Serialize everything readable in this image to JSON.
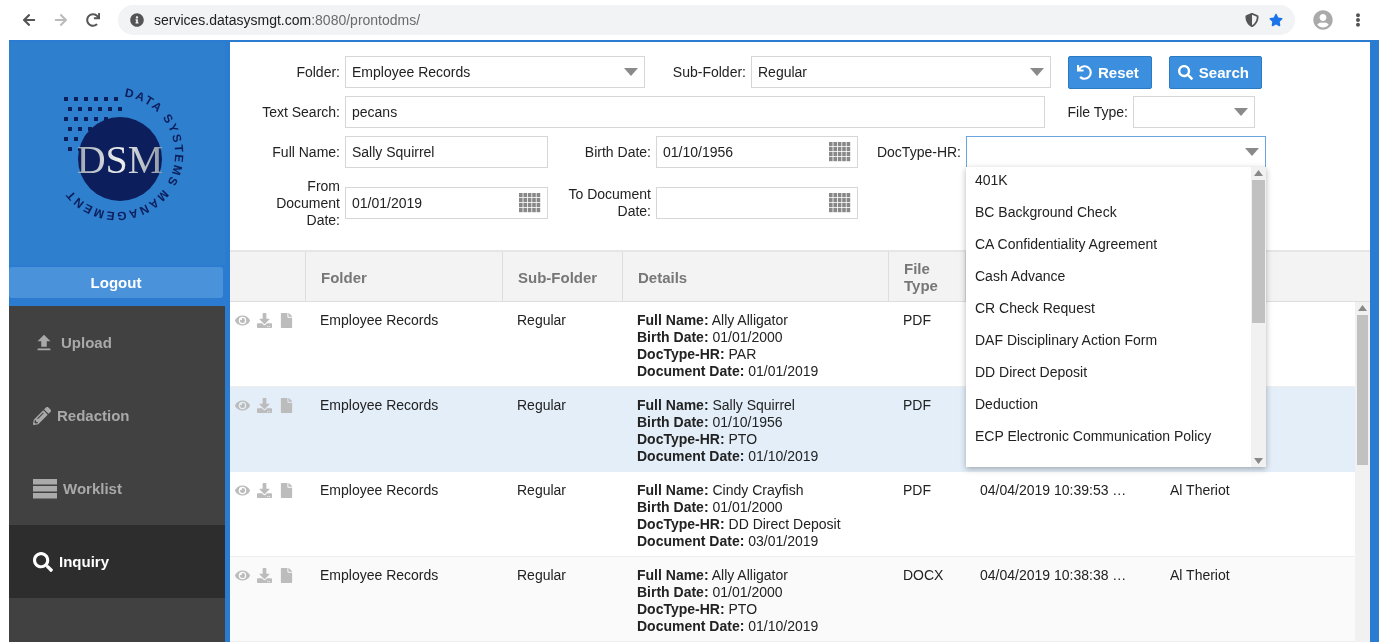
{
  "browser": {
    "url_host": "services.datasysmgt.com",
    "url_path": ":8080/prontodms/"
  },
  "logo": {
    "letters": "DSM",
    "ring_text": "DATA SYSTEMS MANAGEMENT"
  },
  "sidebar": {
    "logout": "Logout",
    "items": [
      {
        "label": "Upload",
        "kind": "upload",
        "selected": false
      },
      {
        "label": "Redaction",
        "kind": "redaction",
        "selected": false
      },
      {
        "label": "Worklist",
        "kind": "worklist",
        "selected": false
      },
      {
        "label": "Inquiry",
        "kind": "inquiry",
        "selected": true
      }
    ]
  },
  "form": {
    "folder": {
      "label": "Folder:",
      "value": "Employee Records"
    },
    "sub_folder": {
      "label": "Sub-Folder:",
      "value": "Regular"
    },
    "reset_button": "Reset",
    "search_button": "Search",
    "text_search": {
      "label": "Text Search:",
      "value": "pecans"
    },
    "file_type": {
      "label": "File Type:"
    },
    "full_name": {
      "label": "Full Name:",
      "value": "Sally Squirrel"
    },
    "birth_date": {
      "label": "Birth Date:",
      "value": "01/10/1956"
    },
    "doctype_hr": {
      "label": "DocType-HR:",
      "expanded": true,
      "options": [
        "401K",
        "BC Background Check",
        "CA Confidentiality Agreement",
        "Cash Advance",
        "CR Check Request",
        "DAF Disciplinary Action Form",
        "DD Direct Deposit",
        "Deduction",
        "ECP Electronic Communication Policy"
      ]
    },
    "from_date": {
      "label": "From Document Date:",
      "value": "01/01/2019"
    },
    "to_date": {
      "label": "To Document Date:"
    }
  },
  "table": {
    "columns": [
      "Folder",
      "Sub-Folder",
      "Details",
      "File Type"
    ],
    "rows": [
      {
        "selected": false,
        "folder": "Employee Records",
        "sub_folder": "Regular",
        "details": [
          "**Full Name:** Ally Alligator",
          "**Birth Date:** 01/01/2000",
          "**DocType-HR:** PAR",
          "**Document Date:** 01/01/2019"
        ],
        "file_type": "PDF"
      },
      {
        "selected": true,
        "folder": "Employee Records",
        "sub_folder": "Regular",
        "details": [
          "**Full Name:** Sally Squirrel",
          "**Birth Date:** 01/10/1956",
          "**DocType-HR:** PTO",
          "**Document Date:** 01/10/2019"
        ],
        "file_type": "PDF"
      },
      {
        "selected": false,
        "folder": "Employee Records",
        "sub_folder": "Regular",
        "details": [
          "**Full Name:** Cindy Crayfish",
          "**Birth Date:** 01/01/2000",
          "**DocType-HR:** DD Direct Deposit",
          "**Document Date:** 03/01/2019"
        ],
        "file_type": "PDF",
        "date": "04/04/2019 10:39:53 …",
        "user": "Al Theriot"
      },
      {
        "selected": false,
        "folder": "Employee Records",
        "sub_folder": "Regular",
        "details": [
          "**Full Name:** Ally Alligator",
          "**Birth Date:** 01/01/2000",
          "**DocType-HR:** PTO",
          "**Document Date:** 01/10/2019"
        ],
        "file_type": "DOCX",
        "date": "04/04/2019 10:38:38 …",
        "user": "Al Theriot"
      }
    ]
  }
}
